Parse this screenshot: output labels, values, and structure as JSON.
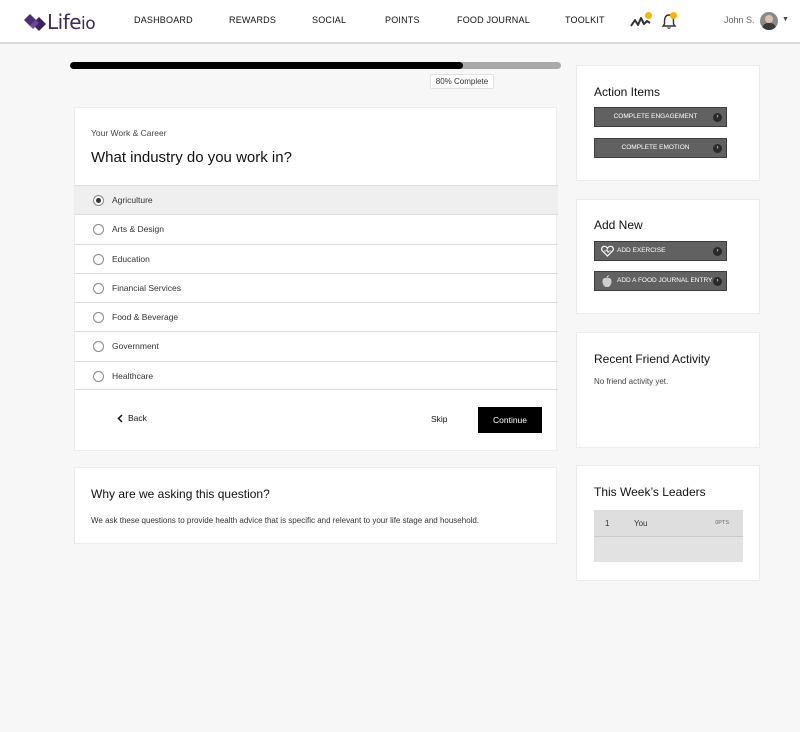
{
  "app": {
    "logo_text": "Life",
    "logo_suffix": "io"
  },
  "nav": {
    "items": [
      "DASHBOARD",
      "REWARDS",
      "SOCIAL",
      "POINTS",
      "FOOD JOURNAL",
      "TOOLKIT"
    ],
    "icons": [
      "activity-icon",
      "bell-icon"
    ],
    "notification_color": "#f5b800"
  },
  "user": {
    "name": "John S."
  },
  "progress": {
    "percent": 80,
    "label": "80% Complete"
  },
  "question": {
    "category": "Your Work & Career",
    "title": "What industry do you work in?",
    "options": [
      {
        "label": "Agriculture",
        "selected": true
      },
      {
        "label": "Arts & Design",
        "selected": false
      },
      {
        "label": "Education",
        "selected": false
      },
      {
        "label": "Financial Services",
        "selected": false
      },
      {
        "label": "Food & Beverage",
        "selected": false
      },
      {
        "label": "Government",
        "selected": false
      },
      {
        "label": "Healthcare",
        "selected": false
      }
    ],
    "back_label": "Back",
    "skip_label": "Skip",
    "continue_label": "Continue"
  },
  "why": {
    "title": "Why are we asking this question?",
    "text": "We ask these questions to provide health advice that is specific and relevant to your life stage and household."
  },
  "sidebar": {
    "action_items": {
      "title": "Action Items",
      "buttons": [
        "COMPLETE ENGAGEMENT",
        "COMPLETE EMOTION"
      ]
    },
    "add_new": {
      "title": "Add New",
      "buttons": [
        {
          "label": "ADD EXERCISE",
          "icon": "heart-icon"
        },
        {
          "label": "ADD A FOOD JOURNAL ENTRY",
          "icon": "apple-icon"
        }
      ]
    },
    "friend_activity": {
      "title": "Recent Friend Activity",
      "empty_text": "No friend activity yet."
    },
    "leaders": {
      "title": "This Week’s Leaders",
      "rows": [
        {
          "rank": "1",
          "name": "You",
          "points": "0PTS"
        }
      ]
    }
  }
}
